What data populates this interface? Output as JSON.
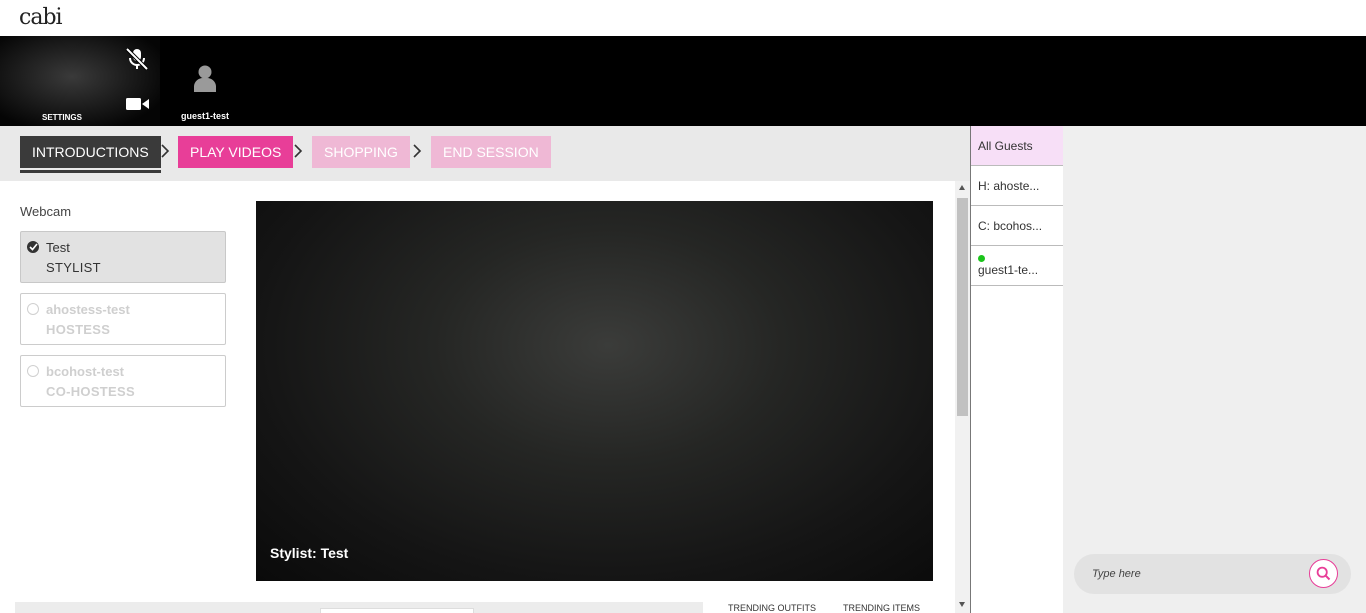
{
  "app": {
    "logo": "cabi"
  },
  "video_strip": {
    "self_label": "SETTINGS",
    "guest_label": "guest1-test"
  },
  "steps": {
    "introductions": "INTRODUCTIONS",
    "play_videos": "PLAY VIDEOS",
    "shopping": "SHOPPING",
    "end_session": "END SESSION"
  },
  "webcam": {
    "title": "Webcam",
    "participants": [
      {
        "name": "Test",
        "role": "STYLIST",
        "selected": true
      },
      {
        "name": "ahostess-test",
        "role": "HOSTESS",
        "selected": false
      },
      {
        "name": "bcohost-test",
        "role": "CO-HOSTESS",
        "selected": false
      }
    ],
    "stage_caption": "Stylist: Test"
  },
  "bottom_tabs": {
    "trending_outfits": "TRENDING OUTFITS",
    "trending_items": "TRENDING ITEMS"
  },
  "guest_list": {
    "items": [
      {
        "label": "All Guests"
      },
      {
        "label": "H: ahoste..."
      },
      {
        "label": "C: bcohos..."
      },
      {
        "label": "guest1-te..."
      }
    ]
  },
  "chat": {
    "placeholder": "Type here"
  },
  "colors": {
    "accent": "#e83e98",
    "accent_light": "#efb8d5",
    "dark": "#3a3a3a",
    "online": "#1bc41b"
  }
}
